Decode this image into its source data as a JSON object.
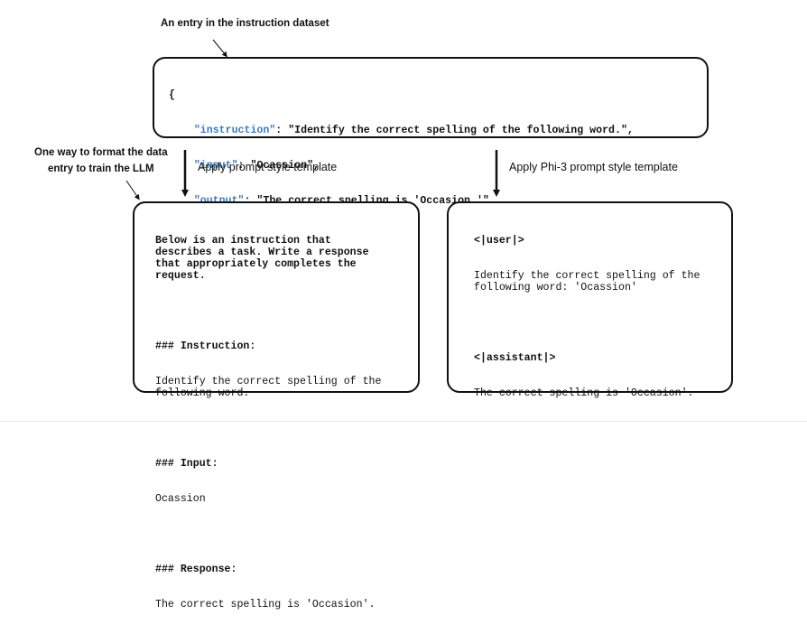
{
  "annotations": {
    "entry_caption": "An entry in the instruction dataset",
    "format_caption_line1": "One way to format the data",
    "format_caption_line2": "entry to train the LLM"
  },
  "json_entry": {
    "open_brace": "{",
    "instruction_key": "\"instruction\"",
    "instruction_value": ": \"Identify the correct spelling of the following word.\",",
    "input_key": "\"input\"",
    "input_value": ": \"Ocassion\",",
    "output_key": "\"output\"",
    "output_value": ": \"The correct spelling is 'Occasion.'\"",
    "close_brace": "},"
  },
  "arrows": {
    "left_label": "Apply prompt style template",
    "right_label": "Apply Phi-3 prompt style template"
  },
  "alpaca_template": {
    "intro": "Below is an instruction that\ndescribes a task. Write a response\nthat appropriately completes the\nrequest.",
    "instruction_header": "### Instruction:",
    "instruction_body": "Identify the correct spelling of the\nfollowing word.",
    "input_header": "### Input:",
    "input_body": "Ocassion",
    "response_header": "### Response:",
    "response_body": "The correct spelling is 'Occasion'."
  },
  "phi3_template": {
    "user_tag": "<|user|>",
    "user_body": "Identify the correct spelling of the\nfollowing word: 'Ocassion'",
    "assistant_tag": "<|assistant|>",
    "assistant_body": "The correct spelling is 'Occasion'."
  }
}
